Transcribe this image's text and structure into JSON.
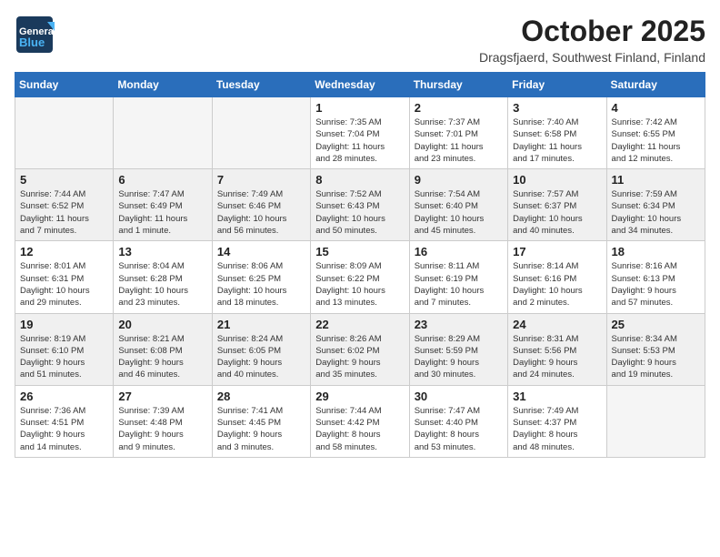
{
  "header": {
    "logo_line1": "General",
    "logo_line2": "Blue",
    "month": "October 2025",
    "location": "Dragsfjaerd, Southwest Finland, Finland"
  },
  "weekdays": [
    "Sunday",
    "Monday",
    "Tuesday",
    "Wednesday",
    "Thursday",
    "Friday",
    "Saturday"
  ],
  "weeks": [
    [
      {
        "day": "",
        "info": ""
      },
      {
        "day": "",
        "info": ""
      },
      {
        "day": "",
        "info": ""
      },
      {
        "day": "1",
        "info": "Sunrise: 7:35 AM\nSunset: 7:04 PM\nDaylight: 11 hours\nand 28 minutes."
      },
      {
        "day": "2",
        "info": "Sunrise: 7:37 AM\nSunset: 7:01 PM\nDaylight: 11 hours\nand 23 minutes."
      },
      {
        "day": "3",
        "info": "Sunrise: 7:40 AM\nSunset: 6:58 PM\nDaylight: 11 hours\nand 17 minutes."
      },
      {
        "day": "4",
        "info": "Sunrise: 7:42 AM\nSunset: 6:55 PM\nDaylight: 11 hours\nand 12 minutes."
      }
    ],
    [
      {
        "day": "5",
        "info": "Sunrise: 7:44 AM\nSunset: 6:52 PM\nDaylight: 11 hours\nand 7 minutes."
      },
      {
        "day": "6",
        "info": "Sunrise: 7:47 AM\nSunset: 6:49 PM\nDaylight: 11 hours\nand 1 minute."
      },
      {
        "day": "7",
        "info": "Sunrise: 7:49 AM\nSunset: 6:46 PM\nDaylight: 10 hours\nand 56 minutes."
      },
      {
        "day": "8",
        "info": "Sunrise: 7:52 AM\nSunset: 6:43 PM\nDaylight: 10 hours\nand 50 minutes."
      },
      {
        "day": "9",
        "info": "Sunrise: 7:54 AM\nSunset: 6:40 PM\nDaylight: 10 hours\nand 45 minutes."
      },
      {
        "day": "10",
        "info": "Sunrise: 7:57 AM\nSunset: 6:37 PM\nDaylight: 10 hours\nand 40 minutes."
      },
      {
        "day": "11",
        "info": "Sunrise: 7:59 AM\nSunset: 6:34 PM\nDaylight: 10 hours\nand 34 minutes."
      }
    ],
    [
      {
        "day": "12",
        "info": "Sunrise: 8:01 AM\nSunset: 6:31 PM\nDaylight: 10 hours\nand 29 minutes."
      },
      {
        "day": "13",
        "info": "Sunrise: 8:04 AM\nSunset: 6:28 PM\nDaylight: 10 hours\nand 23 minutes."
      },
      {
        "day": "14",
        "info": "Sunrise: 8:06 AM\nSunset: 6:25 PM\nDaylight: 10 hours\nand 18 minutes."
      },
      {
        "day": "15",
        "info": "Sunrise: 8:09 AM\nSunset: 6:22 PM\nDaylight: 10 hours\nand 13 minutes."
      },
      {
        "day": "16",
        "info": "Sunrise: 8:11 AM\nSunset: 6:19 PM\nDaylight: 10 hours\nand 7 minutes."
      },
      {
        "day": "17",
        "info": "Sunrise: 8:14 AM\nSunset: 6:16 PM\nDaylight: 10 hours\nand 2 minutes."
      },
      {
        "day": "18",
        "info": "Sunrise: 8:16 AM\nSunset: 6:13 PM\nDaylight: 9 hours\nand 57 minutes."
      }
    ],
    [
      {
        "day": "19",
        "info": "Sunrise: 8:19 AM\nSunset: 6:10 PM\nDaylight: 9 hours\nand 51 minutes."
      },
      {
        "day": "20",
        "info": "Sunrise: 8:21 AM\nSunset: 6:08 PM\nDaylight: 9 hours\nand 46 minutes."
      },
      {
        "day": "21",
        "info": "Sunrise: 8:24 AM\nSunset: 6:05 PM\nDaylight: 9 hours\nand 40 minutes."
      },
      {
        "day": "22",
        "info": "Sunrise: 8:26 AM\nSunset: 6:02 PM\nDaylight: 9 hours\nand 35 minutes."
      },
      {
        "day": "23",
        "info": "Sunrise: 8:29 AM\nSunset: 5:59 PM\nDaylight: 9 hours\nand 30 minutes."
      },
      {
        "day": "24",
        "info": "Sunrise: 8:31 AM\nSunset: 5:56 PM\nDaylight: 9 hours\nand 24 minutes."
      },
      {
        "day": "25",
        "info": "Sunrise: 8:34 AM\nSunset: 5:53 PM\nDaylight: 9 hours\nand 19 minutes."
      }
    ],
    [
      {
        "day": "26",
        "info": "Sunrise: 7:36 AM\nSunset: 4:51 PM\nDaylight: 9 hours\nand 14 minutes."
      },
      {
        "day": "27",
        "info": "Sunrise: 7:39 AM\nSunset: 4:48 PM\nDaylight: 9 hours\nand 9 minutes."
      },
      {
        "day": "28",
        "info": "Sunrise: 7:41 AM\nSunset: 4:45 PM\nDaylight: 9 hours\nand 3 minutes."
      },
      {
        "day": "29",
        "info": "Sunrise: 7:44 AM\nSunset: 4:42 PM\nDaylight: 8 hours\nand 58 minutes."
      },
      {
        "day": "30",
        "info": "Sunrise: 7:47 AM\nSunset: 4:40 PM\nDaylight: 8 hours\nand 53 minutes."
      },
      {
        "day": "31",
        "info": "Sunrise: 7:49 AM\nSunset: 4:37 PM\nDaylight: 8 hours\nand 48 minutes."
      },
      {
        "day": "",
        "info": ""
      }
    ]
  ]
}
